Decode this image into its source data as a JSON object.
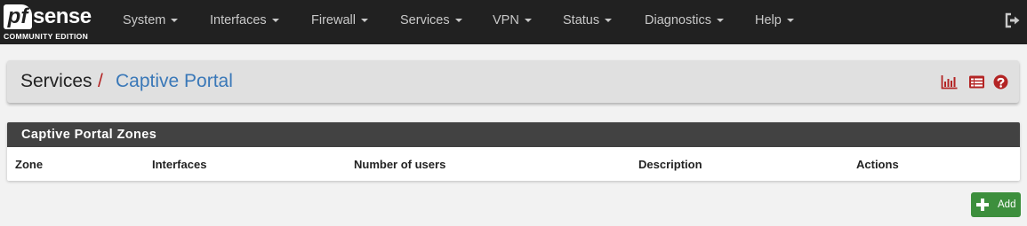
{
  "brand": {
    "pf": "pf",
    "sense": "sense",
    "edition": "COMMUNITY EDITION"
  },
  "nav": {
    "items": [
      {
        "label": "System"
      },
      {
        "label": "Interfaces"
      },
      {
        "label": "Firewall"
      },
      {
        "label": "Services"
      },
      {
        "label": "VPN"
      },
      {
        "label": "Status"
      },
      {
        "label": "Diagnostics"
      },
      {
        "label": "Help"
      }
    ],
    "logout_icon": "sign-out-icon"
  },
  "breadcrumb": {
    "section": "Services",
    "separator": "/",
    "page": "Captive Portal",
    "icons": [
      "bar-chart-icon",
      "list-icon",
      "help-icon"
    ]
  },
  "zones": {
    "title": "Captive Portal Zones",
    "columns": [
      "Zone",
      "Interfaces",
      "Number of users",
      "Description",
      "Actions"
    ],
    "rows": []
  },
  "actions": {
    "add_label": "Add",
    "add_icon": "plus-icon"
  },
  "colors": {
    "navbar": "#212121",
    "link": "#3a78b8",
    "accent_red": "#b32424",
    "panel_heading": "#424242",
    "add_button": "#3d8f3d"
  }
}
